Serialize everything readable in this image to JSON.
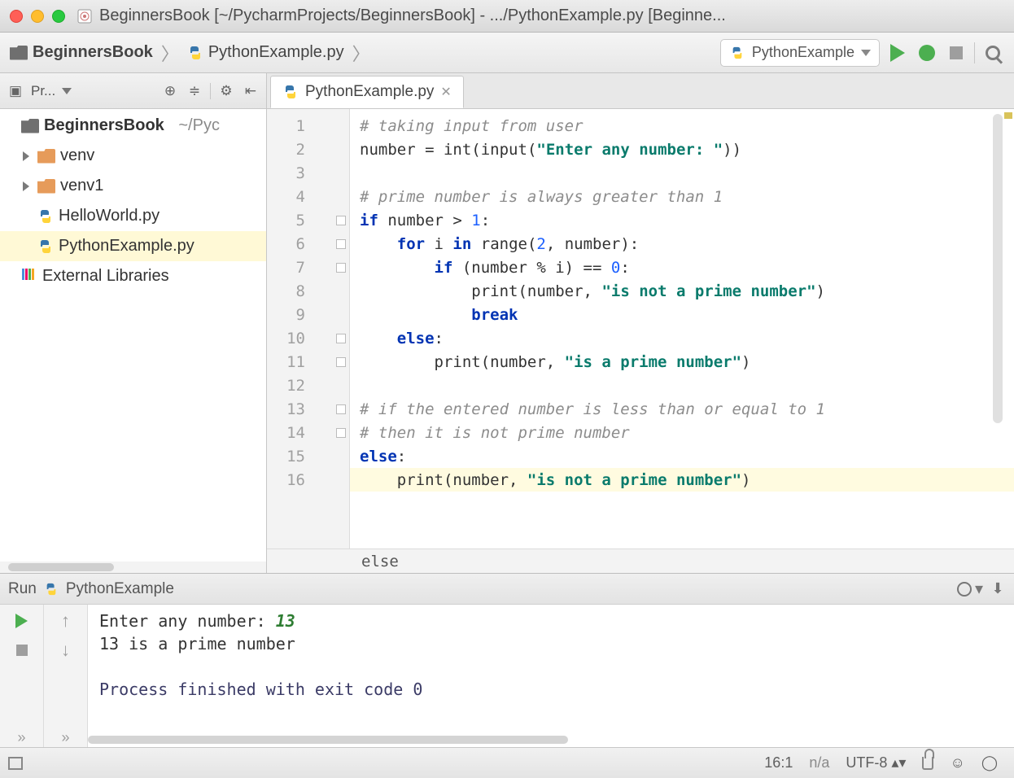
{
  "window": {
    "title": "BeginnersBook [~/PycharmProjects/BeginnersBook] - .../PythonExample.py [Beginne..."
  },
  "breadcrumb": {
    "root": "BeginnersBook",
    "file": "PythonExample.py"
  },
  "run_config": {
    "name": "PythonExample"
  },
  "project_header": {
    "label": "Pr..."
  },
  "project_tree": {
    "root_name": "BeginnersBook",
    "root_path": "~/Pyc",
    "items": [
      {
        "type": "folder",
        "label": "venv"
      },
      {
        "type": "folder",
        "label": "venv1"
      },
      {
        "type": "pyfile",
        "label": "HelloWorld.py"
      },
      {
        "type": "pyfile",
        "label": "PythonExample.py",
        "selected": true
      }
    ],
    "external": "External Libraries"
  },
  "editor": {
    "tab_label": "PythonExample.py",
    "crumb": "else",
    "lines": [
      {
        "n": 1,
        "seg": [
          {
            "t": "# taking input from user",
            "c": "c-comment"
          }
        ]
      },
      {
        "n": 2,
        "seg": [
          {
            "t": "number = "
          },
          {
            "t": "int",
            "c": "c-fn"
          },
          {
            "t": "("
          },
          {
            "t": "input",
            "c": "c-fn"
          },
          {
            "t": "("
          },
          {
            "t": "\"Enter any number: \"",
            "c": "c-str"
          },
          {
            "t": "))"
          }
        ]
      },
      {
        "n": 3,
        "seg": []
      },
      {
        "n": 4,
        "seg": [
          {
            "t": "# prime number is always greater than 1",
            "c": "c-comment"
          }
        ]
      },
      {
        "n": 5,
        "seg": [
          {
            "t": "if ",
            "c": "c-kw"
          },
          {
            "t": "number > "
          },
          {
            "t": "1",
            "c": "c-num"
          },
          {
            "t": ":"
          }
        ],
        "fold": true
      },
      {
        "n": 6,
        "seg": [
          {
            "t": "    "
          },
          {
            "t": "for ",
            "c": "c-kw"
          },
          {
            "t": "i "
          },
          {
            "t": "in ",
            "c": "c-kw"
          },
          {
            "t": "range",
            "c": "c-fn"
          },
          {
            "t": "("
          },
          {
            "t": "2",
            "c": "c-num"
          },
          {
            "t": ", number):"
          }
        ],
        "fold": true
      },
      {
        "n": 7,
        "seg": [
          {
            "t": "        "
          },
          {
            "t": "if ",
            "c": "c-kw"
          },
          {
            "t": "(number % i) == "
          },
          {
            "t": "0",
            "c": "c-num"
          },
          {
            "t": ":"
          }
        ],
        "fold": true
      },
      {
        "n": 8,
        "seg": [
          {
            "t": "            "
          },
          {
            "t": "print",
            "c": "c-fn"
          },
          {
            "t": "(number, "
          },
          {
            "t": "\"is not a prime number\"",
            "c": "c-str"
          },
          {
            "t": ")"
          }
        ]
      },
      {
        "n": 9,
        "seg": [
          {
            "t": "            "
          },
          {
            "t": "break",
            "c": "c-kw"
          }
        ]
      },
      {
        "n": 10,
        "seg": [
          {
            "t": "    "
          },
          {
            "t": "else",
            "c": "c-kw"
          },
          {
            "t": ":"
          }
        ],
        "fold": true
      },
      {
        "n": 11,
        "seg": [
          {
            "t": "        "
          },
          {
            "t": "print",
            "c": "c-fn"
          },
          {
            "t": "(number, "
          },
          {
            "t": "\"is a prime number\"",
            "c": "c-str"
          },
          {
            "t": ")"
          }
        ],
        "fold": true
      },
      {
        "n": 12,
        "seg": []
      },
      {
        "n": 13,
        "seg": [
          {
            "t": "# if the entered number is less than or equal to 1",
            "c": "c-comment"
          }
        ],
        "fold": true
      },
      {
        "n": 14,
        "seg": [
          {
            "t": "# then it is not prime number",
            "c": "c-comment"
          }
        ],
        "fold": true
      },
      {
        "n": 15,
        "seg": [
          {
            "t": "else",
            "c": "c-kw"
          },
          {
            "t": ":"
          }
        ]
      },
      {
        "n": 16,
        "seg": [
          {
            "t": "    "
          },
          {
            "t": "print",
            "c": "c-fn"
          },
          {
            "t": "(number, "
          },
          {
            "t": "\"is not a prime number\"",
            "c": "c-str"
          },
          {
            "t": ")"
          }
        ],
        "hl": true
      }
    ]
  },
  "run_panel": {
    "title": "Run",
    "config": "PythonExample",
    "lines": [
      {
        "seg": [
          {
            "t": "Enter any number: "
          },
          {
            "t": "13",
            "c": "inp"
          }
        ]
      },
      {
        "seg": [
          {
            "t": "13 is a prime number"
          }
        ]
      },
      {
        "seg": []
      },
      {
        "seg": [
          {
            "t": "Process finished with exit code 0",
            "c": "exit"
          }
        ]
      }
    ]
  },
  "status": {
    "pos": "16:1",
    "sep": "n/a",
    "enc": "UTF-8"
  }
}
